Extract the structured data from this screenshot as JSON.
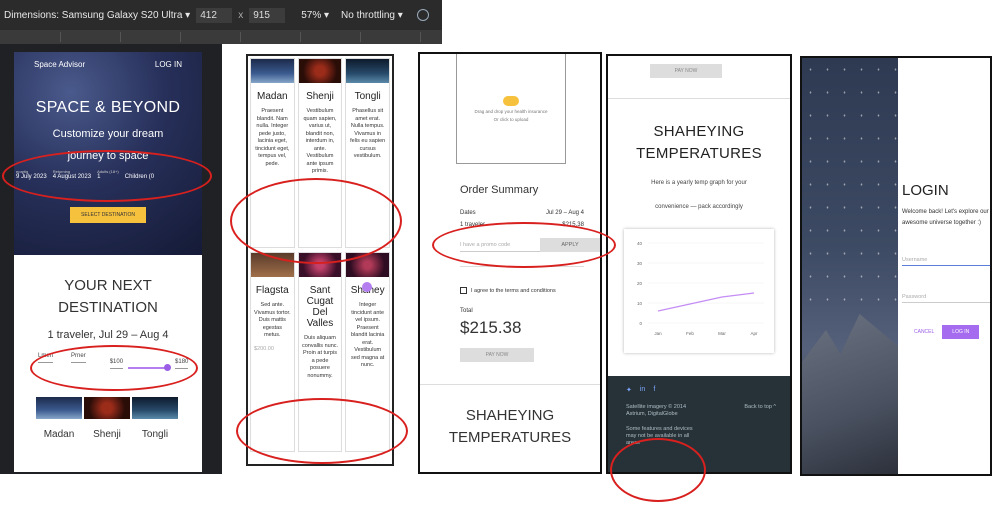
{
  "devtools": {
    "dimensions": "Dimensions: Samsung Galaxy S20 Ultra ▾",
    "width": "412",
    "times": "x",
    "height": "915",
    "zoom": "57% ▾",
    "throttle": "No throttling ▾"
  },
  "panel1": {
    "brand": "Space Advisor",
    "login": "LOG IN",
    "title": "SPACE & BEYOND",
    "subtitle1": "Customize your dream",
    "subtitle2": "journey to space",
    "depart_label": "epartig",
    "depart": "9 July 2023",
    "return_label": "Returning",
    "return": "4 August 2023",
    "adults_label": "Adults (18+)",
    "adults": "1",
    "children": "Children (0",
    "select_button": "SELECT DESTINATION",
    "next_title1": "YOUR NEXT",
    "next_title2": "DESTINATION",
    "traveler": "1 traveler, Jul 29 – Aug 4",
    "price_a": "Lmen",
    "price_b": "Prner",
    "price_min": "$100",
    "price_max": "$180",
    "cards": [
      "Madan",
      "Shenji",
      "Tongli"
    ]
  },
  "panel2": {
    "row1": [
      {
        "name": "Madan",
        "text": "Praesent blandit. Nam nulla. Integer pede justo, lacinia eget, tincidunt eget, tempus vel, pede."
      },
      {
        "name": "Shenji",
        "text": "Vestibulum quam sapien, varius ut, blandit non, interdum in, ante. Vestibulum ante ipsum primis."
      },
      {
        "name": "Tongli",
        "text": "Phasellus sit amet erat. Nulla tempus. Vivamus in felis eu sapien cursus vestibulum."
      }
    ],
    "row2": [
      {
        "name": "Flagsta",
        "text": "Sed ante. Vivamus tortor. Duis mattis egestas metus."
      },
      {
        "name": "Sant Cugat Del Valles",
        "text": "Duis aliquam convallis nunc. Proin at turpis a pede posuere nonummy."
      },
      {
        "name": "Shahey",
        "text": "Integer tincidunt ante vel ipsum. Praesent blandit lacinia erat. Vestibulum sed magna at nunc."
      }
    ],
    "price": "$200.00"
  },
  "panel3": {
    "upload_text1": "Drag and drop your health insurance",
    "upload_text2": "Or click to upload",
    "order_title": "Order Summary",
    "dates_label": "Dates",
    "dates_value": "Jul 29 – Aug 4",
    "traveler_label": "1 traveler",
    "traveler_value": "$215.38",
    "promo_placeholder": "I have a promo code",
    "apply": "APPLY",
    "agree": "I agree to the terms and conditions",
    "total_label": "Total",
    "total": "$215.38",
    "pay": "PAY NOW",
    "temp1": "SHAHEYING",
    "temp2": "TEMPERATURES"
  },
  "panel4": {
    "pay": "PAY NOW",
    "temp1": "SHAHEYING",
    "temp2": "TEMPERATURES",
    "desc1": "Here is a yearly temp graph for your",
    "desc2": "convenience — pack accordingly",
    "footer_credit": "Satellite imagery © 2014 Astrium, DigitalGlobe",
    "back_to_top": "Back to top ^",
    "footer_note": "Some features and devices may not be available in all areas"
  },
  "chart_data": {
    "type": "line",
    "categories": [
      "Jan",
      "Feb",
      "Mar",
      "Apr"
    ],
    "yticks": [
      "40",
      "30",
      "20",
      "10",
      "0"
    ],
    "ylim": [
      0,
      40
    ],
    "series": [
      {
        "values": [
          6,
          9.5,
          13,
          15
        ]
      }
    ],
    "colors": {
      "line": "#c48cf5"
    }
  },
  "panel5": {
    "title": "LOGIN",
    "welcome": "Welcome back! Let's explore our awesome universe together :)",
    "username": "Username",
    "password": "Password",
    "cancel": "CANCEL",
    "login": "LOG IN"
  }
}
